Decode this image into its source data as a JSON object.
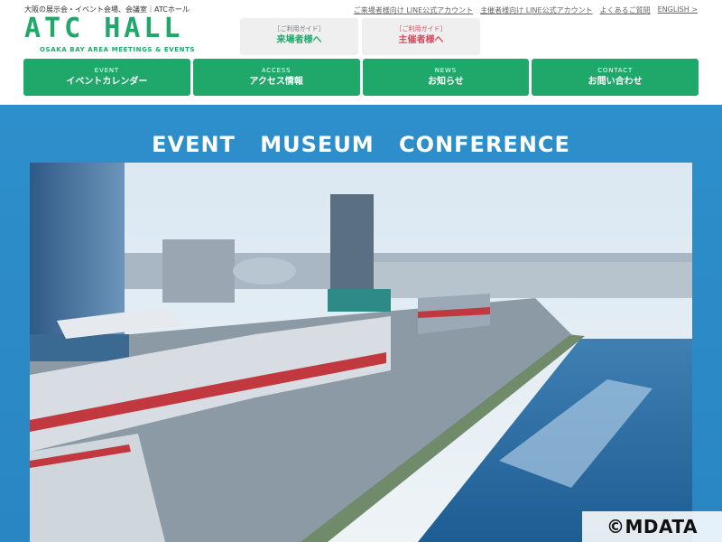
{
  "header": {
    "tagline": "大阪の展示会・イベント会場、会議室｜ATCホール",
    "logo": "ATC HALL",
    "logo_sub": "OSAKA BAY AREA MEETINGS & EVENTS",
    "guide_visitor": {
      "small": "［ご利用ガイド］",
      "label": "来場者様へ"
    },
    "guide_organizer": {
      "small": "［ご利用ガイド］",
      "label": "主催者様へ"
    },
    "links": [
      "ご来場者様向け LINE公式アカウント",
      "主催者様向け LINE公式アカウント",
      "よくあるご質問",
      "ENGLISH >"
    ]
  },
  "nav": [
    {
      "en": "EVENT",
      "jp": "イベントカレンダー"
    },
    {
      "en": "ACCESS",
      "jp": "アクセス情報"
    },
    {
      "en": "NEWS",
      "jp": "お知らせ"
    },
    {
      "en": "CONTACT",
      "jp": "お問い合わせ"
    }
  ],
  "hero": {
    "title": "EVENT MUSEUM CONFERENCE",
    "image_alt": "aerial view of ATC waterfront"
  },
  "copyright": "©MDATA",
  "colors": {
    "brand_green": "#1fa86a",
    "hero_blue": "#2d8fcb",
    "organizer_red": "#d44b5a"
  }
}
